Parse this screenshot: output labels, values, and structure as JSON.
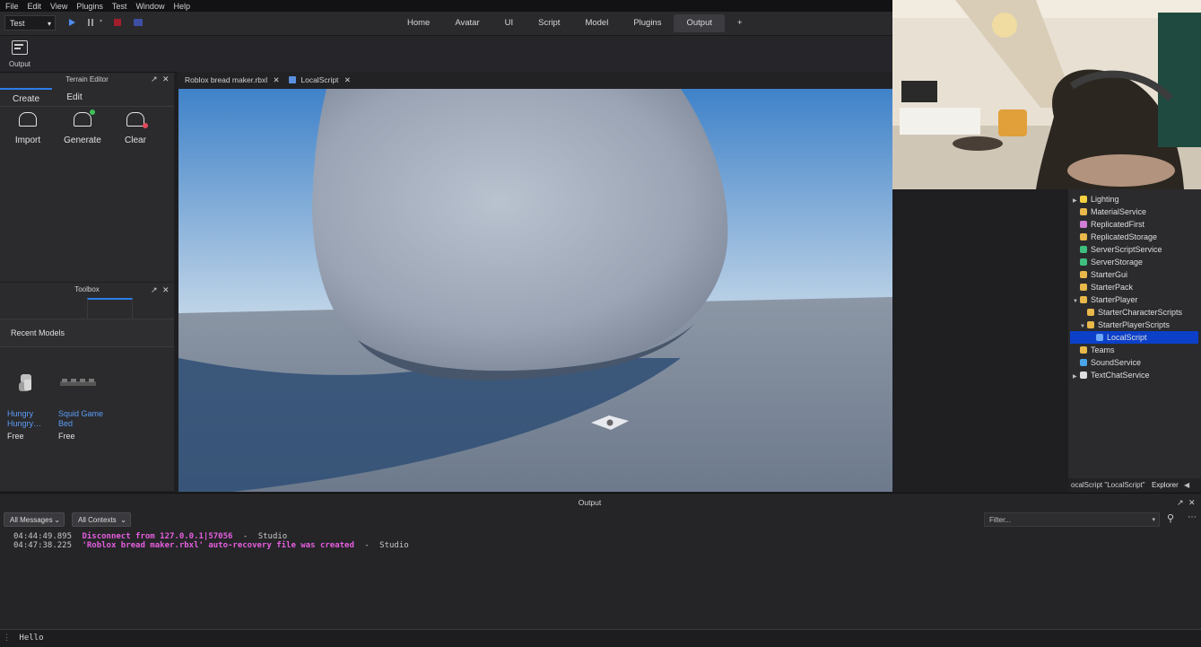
{
  "menubar": {
    "items": [
      "File",
      "Edit",
      "View",
      "Plugins",
      "Test",
      "Window",
      "Help"
    ]
  },
  "toolbar": {
    "mode": "Test"
  },
  "nav_tabs": [
    "Home",
    "Avatar",
    "UI",
    "Script",
    "Model",
    "Plugins",
    "Output",
    "+"
  ],
  "ribbon": {
    "output_label": "Output"
  },
  "terrain": {
    "title": "Terrain Editor",
    "tabs": [
      "Create",
      "Edit"
    ],
    "tools": [
      "Import",
      "Generate",
      "Clear"
    ]
  },
  "toolbox": {
    "title": "Toolbox",
    "section": "Recent Models",
    "models": [
      {
        "name_line1": "Hungry",
        "name_line2": "Hungry…",
        "price": "Free"
      },
      {
        "name_line1": "Squid Game",
        "name_line2": "Bed",
        "price": "Free"
      }
    ]
  },
  "doc_tabs": [
    "Roblox bread maker.rbxl",
    "LocalScript"
  ],
  "explorer": {
    "items": [
      {
        "label": "Lighting",
        "color": "#f5d142"
      },
      {
        "label": "MaterialService",
        "color": "#e8b84a"
      },
      {
        "label": "ReplicatedFirst",
        "color": "#d07dd6"
      },
      {
        "label": "ReplicatedStorage",
        "color": "#e8b84a"
      },
      {
        "label": "ServerScriptService",
        "color": "#3fbf7f"
      },
      {
        "label": "ServerStorage",
        "color": "#3fbf7f"
      },
      {
        "label": "StarterGui",
        "color": "#e8b84a"
      },
      {
        "label": "StarterPack",
        "color": "#e8b84a"
      },
      {
        "label": "StarterPlayer",
        "color": "#e8b84a"
      },
      {
        "label": "StarterCharacterScripts",
        "color": "#e8b84a"
      },
      {
        "label": "StarterPlayerScripts",
        "color": "#e8b84a"
      },
      {
        "label": "LocalScript",
        "color": "#6fa8f5"
      },
      {
        "label": "Teams",
        "color": "#e8b84a"
      },
      {
        "label": "SoundService",
        "color": "#4aa6e8"
      },
      {
        "label": "TextChatService",
        "color": "#dedede"
      }
    ],
    "footer_path": "ocalScript \"LocalScript\"",
    "footer_tab": "Explorer"
  },
  "output": {
    "title": "Output",
    "filter_messages": "All Messages",
    "filter_contexts": "All Contexts",
    "filter_placeholder": "Filter...",
    "logs": [
      {
        "time": "04:44:49.895",
        "message": "Disconnect from 127.0.0.1|57056",
        "source": "Studio"
      },
      {
        "time": "04:47:38.225",
        "message": "'Roblox bread maker.rbxl' auto-recovery file was created",
        "source": "Studio"
      }
    ],
    "command_text": "Hello"
  }
}
